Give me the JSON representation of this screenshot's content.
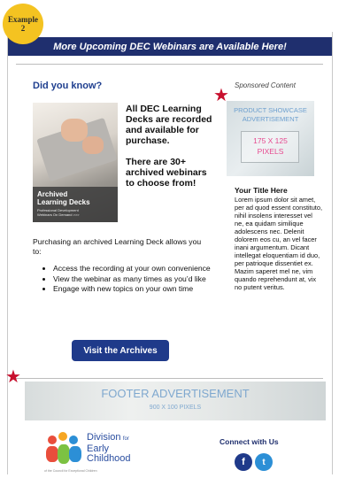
{
  "badge": {
    "line1": "Example",
    "line2": "2"
  },
  "banner": {
    "title": "More Upcoming DEC Webinars are Available Here!"
  },
  "main": {
    "heading": "Did you know?",
    "deck_image": {
      "title_line1": "Archived",
      "title_line2": "Learning Decks",
      "subtitle_line1": "Professional Development",
      "subtitle_line2": "Webinars On Demand >>>"
    },
    "promo_line1": "All DEC Learning Decks are recorded and available for purchase.",
    "promo_line2": "There are 30+ archived webinars to choose from!",
    "purchasing": "Purchasing an archived Learning Deck allows you to:",
    "bullets": [
      "Access the recording at your own convenience",
      "View the webinar as many times as you’d like",
      "Engage with new topics on your own time"
    ],
    "button": "Visit the Archives"
  },
  "sidebar": {
    "sponsored": "Sponsored Content",
    "ad_line1": "PRODUCT SHOWCASE",
    "ad_line2": "ADVERTISEMENT",
    "ad_line3": "175 X 125",
    "ad_line4": "PIXELS",
    "title": "Your Title Here",
    "body": "Lorem ipsum dolor sit amet, per ad quod essent constituto, nihil insolens interesset vel ne, ea quidam similique adolescens nec. Delenit dolorem eos cu, an vel facer inani argumentum. Dicant intellegat eloquentiam id duo, per patrioque dissentiet ex. Mazim saperet mel ne, vim quando reprehendunt at, vix no putent veritus."
  },
  "footer": {
    "ad_line1": "FOOTER ADVERTISEMENT",
    "ad_line2": "900 X 100 PIXELS",
    "logo_line1": "Division",
    "logo_line1b": "for",
    "logo_line2": "Early",
    "logo_line3": "Childhood",
    "logo_tag": "of the Council for Exceptional Children",
    "connect": "Connect with Us",
    "facebook_glyph": "f",
    "twitter_glyph": "t"
  },
  "icons": {
    "star": "star-icon",
    "facebook": "facebook-icon",
    "twitter": "twitter-icon"
  },
  "colors": {
    "navy": "#1f2f6e",
    "button": "#1f3a8a",
    "heading": "#1f3f8f",
    "badge": "#f4c321",
    "star": "#c8102e"
  }
}
